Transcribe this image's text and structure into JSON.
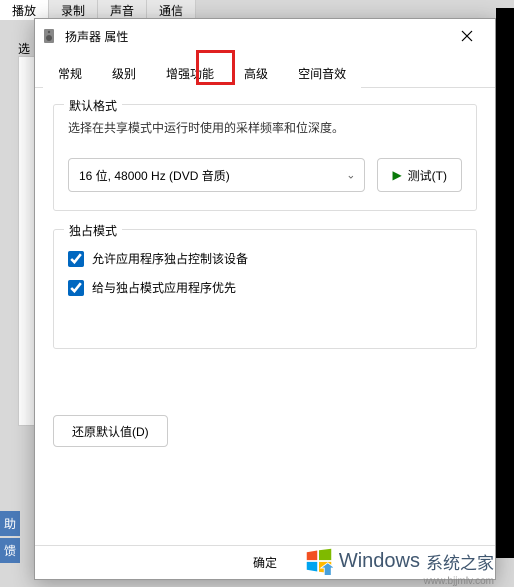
{
  "background": {
    "tabs": [
      "播放",
      "录制",
      "声音",
      "通信"
    ],
    "left_label": "选",
    "bottom_items": [
      "助",
      "馈"
    ]
  },
  "dialog": {
    "title": "扬声器 属性",
    "tabs": [
      {
        "label": "常规"
      },
      {
        "label": "级别"
      },
      {
        "label": "增强功能"
      },
      {
        "label": "高级"
      },
      {
        "label": "空间音效"
      }
    ],
    "active_tab_index": 3,
    "default_format": {
      "group_title": "默认格式",
      "description": "选择在共享模式中运行时使用的采样频率和位深度。",
      "selected_value": "16 位, 48000 Hz (DVD 音质)",
      "test_button": "测试(T)"
    },
    "exclusive_mode": {
      "group_title": "独占模式",
      "option1": {
        "label": "允许应用程序独占控制该设备",
        "checked": true
      },
      "option2": {
        "label": "给与独占模式应用程序优先",
        "checked": true
      }
    },
    "reset_button": "还原默认值(D)",
    "ok_button": "确定"
  },
  "watermark": {
    "brand": "Windows",
    "cn": "系统之家",
    "url": "www.bjjmlv.com"
  }
}
